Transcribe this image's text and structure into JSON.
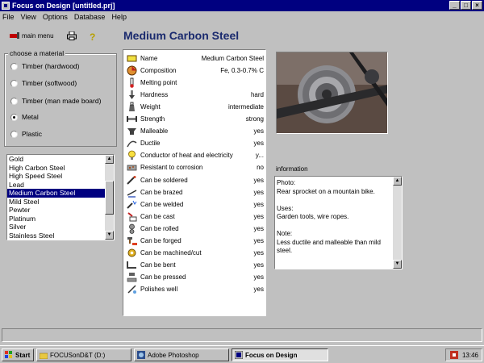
{
  "window": {
    "title": "Focus on Design [untitled.prj]"
  },
  "menu": [
    "File",
    "View",
    "Options",
    "Database",
    "Help"
  ],
  "toolbar": {
    "main_menu_label": "main menu"
  },
  "heading": "Medium Carbon Steel",
  "material_group": {
    "title": "choose a material",
    "options": [
      {
        "label": "Timber (hardwood)",
        "selected": false
      },
      {
        "label": "Timber (softwood)",
        "selected": false
      },
      {
        "label": "Timber (man made board)",
        "selected": false
      },
      {
        "label": "Metal",
        "selected": true
      },
      {
        "label": "Plastic",
        "selected": false
      }
    ]
  },
  "material_list": {
    "items": [
      "Gold",
      "High Carbon Steel",
      "High Speed Steel",
      "Lead",
      "Medium Carbon Steel",
      "Mild Steel",
      "Pewter",
      "Platinum",
      "Silver",
      "Stainless Steel"
    ],
    "selected": "Medium Carbon Steel"
  },
  "properties": [
    {
      "name": "Name",
      "value": "Medium Carbon Steel",
      "icon": "name-tag-icon"
    },
    {
      "name": "Composition",
      "value": "Fe, 0.3-0.7% C",
      "icon": "composition-icon"
    },
    {
      "name": "Melting point",
      "value": "",
      "icon": "thermometer-icon"
    },
    {
      "name": "Hardness",
      "value": "hard",
      "icon": "hardness-icon"
    },
    {
      "name": "Weight",
      "value": "intermediate",
      "icon": "weight-icon"
    },
    {
      "name": "Strength",
      "value": "strong",
      "icon": "strength-icon"
    },
    {
      "name": "Malleable",
      "value": "yes",
      "icon": "anvil-icon"
    },
    {
      "name": "Ductile",
      "value": "yes",
      "icon": "ductile-icon"
    },
    {
      "name": "Conductor of heat and electricity",
      "value": "y...",
      "icon": "lightbulb-icon"
    },
    {
      "name": "Resistant to corrosion",
      "value": "no",
      "icon": "corrosion-icon"
    },
    {
      "name": "Can be soldered",
      "value": "yes",
      "icon": "soldering-iron-icon"
    },
    {
      "name": "Can be brazed",
      "value": "yes",
      "icon": "brazing-icon"
    },
    {
      "name": "Can be welded",
      "value": "yes",
      "icon": "welding-icon"
    },
    {
      "name": "Can be cast",
      "value": "yes",
      "icon": "cast-icon"
    },
    {
      "name": "Can be rolled",
      "value": "yes",
      "icon": "rolled-icon"
    },
    {
      "name": "Can be forged",
      "value": "yes",
      "icon": "forged-icon"
    },
    {
      "name": "Can be machined/cut",
      "value": "yes",
      "icon": "gear-icon"
    },
    {
      "name": "Can be bent",
      "value": "yes",
      "icon": "bent-icon"
    },
    {
      "name": "Can be pressed",
      "value": "yes",
      "icon": "pressed-icon"
    },
    {
      "name": "Polishes well",
      "value": "yes",
      "icon": "polish-icon"
    }
  ],
  "information": {
    "label": "information",
    "text": "Photo:\nRear sprocket on a mountain bike.\n\nUses:\nGarden tools, wire ropes.\n\nNote:\nLess ductile and malleable than mild steel."
  },
  "taskbar": {
    "start_label": "Start",
    "tasks": [
      {
        "label": "FOCUSonD&T (D:)",
        "active": false
      },
      {
        "label": "Adobe Photoshop",
        "active": false
      },
      {
        "label": "Focus on Design",
        "active": true
      }
    ],
    "clock": "13:46"
  }
}
